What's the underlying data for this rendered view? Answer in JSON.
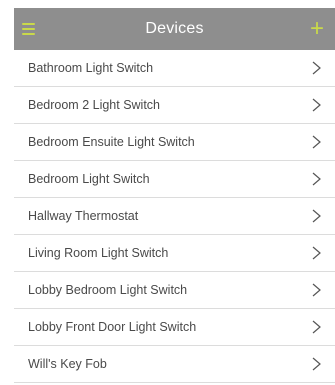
{
  "header": {
    "title": "Devices",
    "accent_color": "#c9d94a",
    "background_color": "#8e8e8e",
    "menu_icon": "menu-icon",
    "add_icon": "plus-icon",
    "add_symbol": "+"
  },
  "devices": [
    {
      "label": "Bathroom Light Switch"
    },
    {
      "label": "Bedroom 2 Light Switch"
    },
    {
      "label": "Bedroom Ensuite Light Switch"
    },
    {
      "label": "Bedroom Light Switch"
    },
    {
      "label": "Hallway Thermostat"
    },
    {
      "label": "Living Room Light Switch"
    },
    {
      "label": "Lobby Bedroom Light Switch"
    },
    {
      "label": "Lobby Front Door Light Switch"
    },
    {
      "label": "Will's Key Fob"
    }
  ],
  "row_icon": "chevron-right-icon"
}
